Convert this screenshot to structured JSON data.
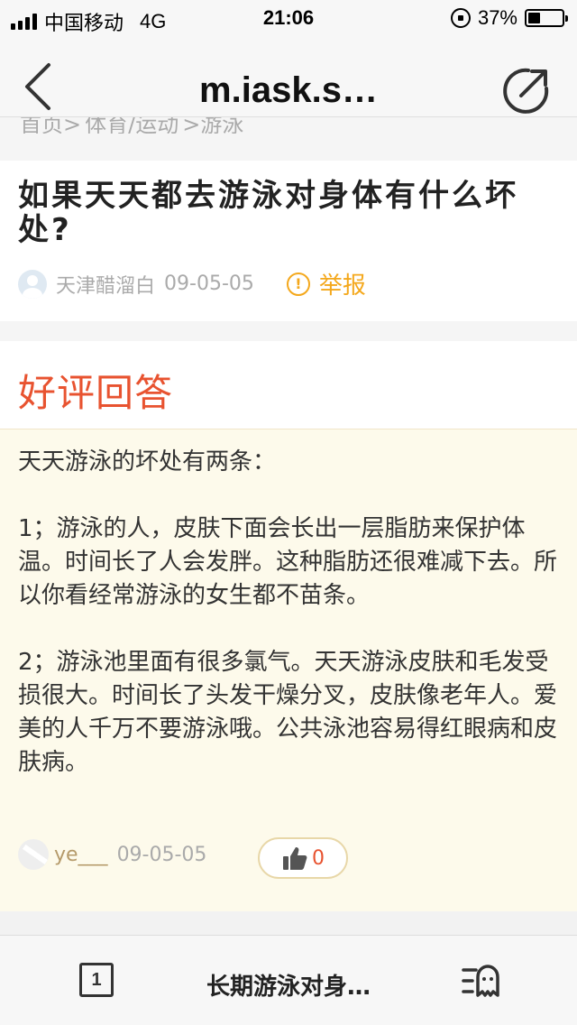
{
  "status_bar": {
    "carrier": "中国移动",
    "network": "4G",
    "time": "21:06",
    "battery_percent": "37%",
    "battery_level": 0.37
  },
  "nav": {
    "title": "m.iask.s…"
  },
  "breadcrumb": {
    "items": [
      "首页>",
      "体育/运动",
      ">游泳"
    ]
  },
  "question": {
    "title": "如果天天都去游泳对身体有什么坏处?",
    "asker": "天津醋溜白",
    "date": "09-05-05",
    "report_label": "举报",
    "report_icon": "exclamation-circle-icon"
  },
  "answer": {
    "section_title": "好评回答",
    "paragraphs": [
      "天天游泳的坏处有两条：",
      "1；游泳的人，皮肤下面会长出一层脂肪来保护体温。时间长了人会发胖。这种脂肪还很难减下去。所以你看经常游泳的女生都不苗条。",
      "2；游泳池里面有很多氯气。天天游泳皮肤和毛发受损很大。时间长了头发干燥分叉，皮肤像老年人。爱美的人千万不要游泳哦。公共泳池容易得红眼病和皮肤病。"
    ],
    "answerer": "ye___",
    "date": "09-05-05",
    "like_count": "0"
  },
  "toolbar": {
    "page_number": "1",
    "title": "长期游泳对身…"
  },
  "colors": {
    "accent_red": "#e85330",
    "report_orange": "#f4a81c",
    "answer_bg": "#fdfaeb"
  }
}
